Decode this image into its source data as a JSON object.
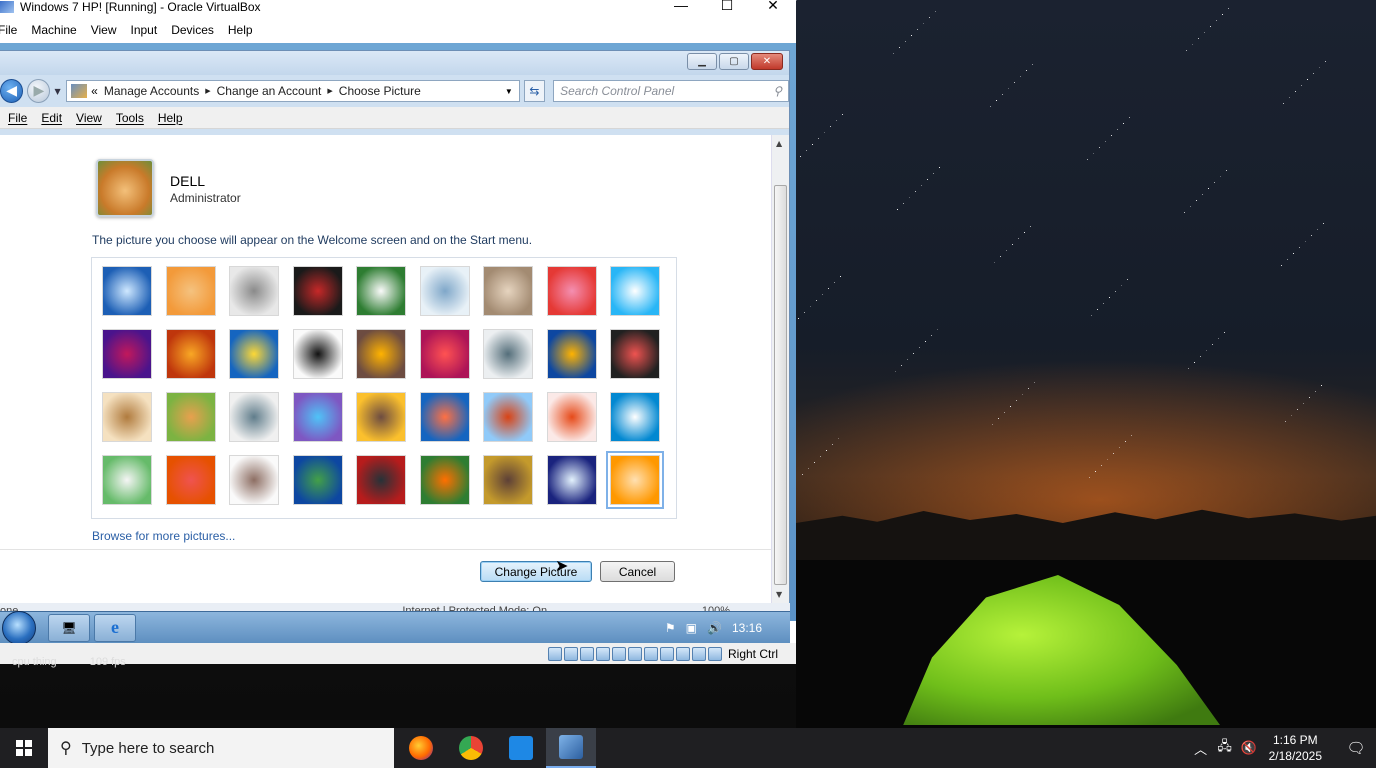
{
  "vbox": {
    "title": "Windows 7 HP! [Running] - Oracle VirtualBox",
    "menu": [
      "File",
      "Machine",
      "View",
      "Input",
      "Devices",
      "Help"
    ],
    "minimize": "—",
    "maximize": "☐",
    "close": "✕",
    "status_right": "Right Ctrl"
  },
  "guest": {
    "caption_buttons": {
      "min": "▁",
      "max": "▢",
      "close": "✕"
    },
    "breadcrumbs": [
      "Manage Accounts",
      "Change an Account",
      "Choose Picture"
    ],
    "breadcrumb_prefix": "«",
    "search_placeholder": "Search Control Panel",
    "menu": [
      "File",
      "Edit",
      "View",
      "Tools",
      "Help"
    ],
    "user": {
      "name": "DELL",
      "role": "Administrator"
    },
    "description": "The picture you choose will appear on the Welcome screen and on the Start menu.",
    "pictures": [
      {
        "name": "roller-coaster",
        "c1": "#1d5fb5",
        "c2": "#cfe8ff"
      },
      {
        "name": "starfish",
        "c1": "#f39a3a",
        "c2": "#f4c27f"
      },
      {
        "name": "robot-figure",
        "c1": "#e8e8e8",
        "c2": "#8a8a8a"
      },
      {
        "name": "vinyl",
        "c1": "#1a1a1a",
        "c2": "#c62828"
      },
      {
        "name": "lucky-cat",
        "c1": "#2e7d32",
        "c2": "#fafafa"
      },
      {
        "name": "gyroscope",
        "c1": "#e8f1f7",
        "c2": "#7fa7c9"
      },
      {
        "name": "kitten",
        "c1": "#a38b72",
        "c2": "#e6d4bf"
      },
      {
        "name": "flower-pink",
        "c1": "#e53935",
        "c2": "#f48fb1"
      },
      {
        "name": "pinwheel",
        "c1": "#29b6f6",
        "c2": "#ffffff"
      },
      {
        "name": "ball",
        "c1": "#4a148c",
        "c2": "#c2185b"
      },
      {
        "name": "fabric",
        "c1": "#bf360c",
        "c2": "#f9a825"
      },
      {
        "name": "leaf",
        "c1": "#1565c0",
        "c2": "#fdd835"
      },
      {
        "name": "dog-bw",
        "c1": "#fafafa",
        "c2": "#111111"
      },
      {
        "name": "crayons",
        "c1": "#6d4c41",
        "c2": "#ffb300"
      },
      {
        "name": "red-star",
        "c1": "#ad1457",
        "c2": "#ff5252"
      },
      {
        "name": "jacks",
        "c1": "#eceff1",
        "c2": "#546e7a"
      },
      {
        "name": "stairs",
        "c1": "#0d47a1",
        "c2": "#ffb300"
      },
      {
        "name": "origami",
        "c1": "#212121",
        "c2": "#ef5350"
      },
      {
        "name": "guitar",
        "c1": "#f5e1c0",
        "c2": "#b07b3e"
      },
      {
        "name": "pomeranian",
        "c1": "#7cb342",
        "c2": "#e8a04e"
      },
      {
        "name": "toy-robot",
        "c1": "#f0f0f0",
        "c2": "#607d8b"
      },
      {
        "name": "scarf",
        "c1": "#7e57c2",
        "c2": "#4fc3f7"
      },
      {
        "name": "sunflower",
        "c1": "#fbc02d",
        "c2": "#6d4c41"
      },
      {
        "name": "fish",
        "c1": "#1565c0",
        "c2": "#ff7043"
      },
      {
        "name": "balloon",
        "c1": "#90caf9",
        "c2": "#d84315"
      },
      {
        "name": "doll",
        "c1": "#fbe9e7",
        "c2": "#e64a19"
      },
      {
        "name": "sailboat",
        "c1": "#0288d1",
        "c2": "#ffffff"
      },
      {
        "name": "soccer",
        "c1": "#66bb6a",
        "c2": "#f5f5f5"
      },
      {
        "name": "rug",
        "c1": "#e65100",
        "c2": "#ef5350"
      },
      {
        "name": "marbles",
        "c1": "#fafafa",
        "c2": "#8d6e63"
      },
      {
        "name": "frame",
        "c1": "#0d47a1",
        "c2": "#43a047"
      },
      {
        "name": "pattern",
        "c1": "#b71c1c",
        "c2": "#263238"
      },
      {
        "name": "butterfly",
        "c1": "#2e7d32",
        "c2": "#ff6f00"
      },
      {
        "name": "shell",
        "c1": "#c49a2c",
        "c2": "#5d4037"
      },
      {
        "name": "lantern",
        "c1": "#1a237e",
        "c2": "#e3f2fd"
      },
      {
        "name": "orange-flower",
        "c1": "#ff9800",
        "c2": "#ffe0b2"
      }
    ],
    "browse_link": "Browse for more pictures...",
    "change_button": "Change Picture",
    "cancel_button": "Cancel",
    "status_zone": "Internet | Protected Mode: On",
    "status_left": "one",
    "zoom": "100%",
    "win7_time": "13:16"
  },
  "host_taskbar": {
    "search_placeholder": "Type here to search",
    "time": "1:16 PM",
    "date": "2/18/2025",
    "notifications": "1"
  },
  "overlay": {
    "cpu": "cpu thing",
    "fps": "109 fps"
  }
}
